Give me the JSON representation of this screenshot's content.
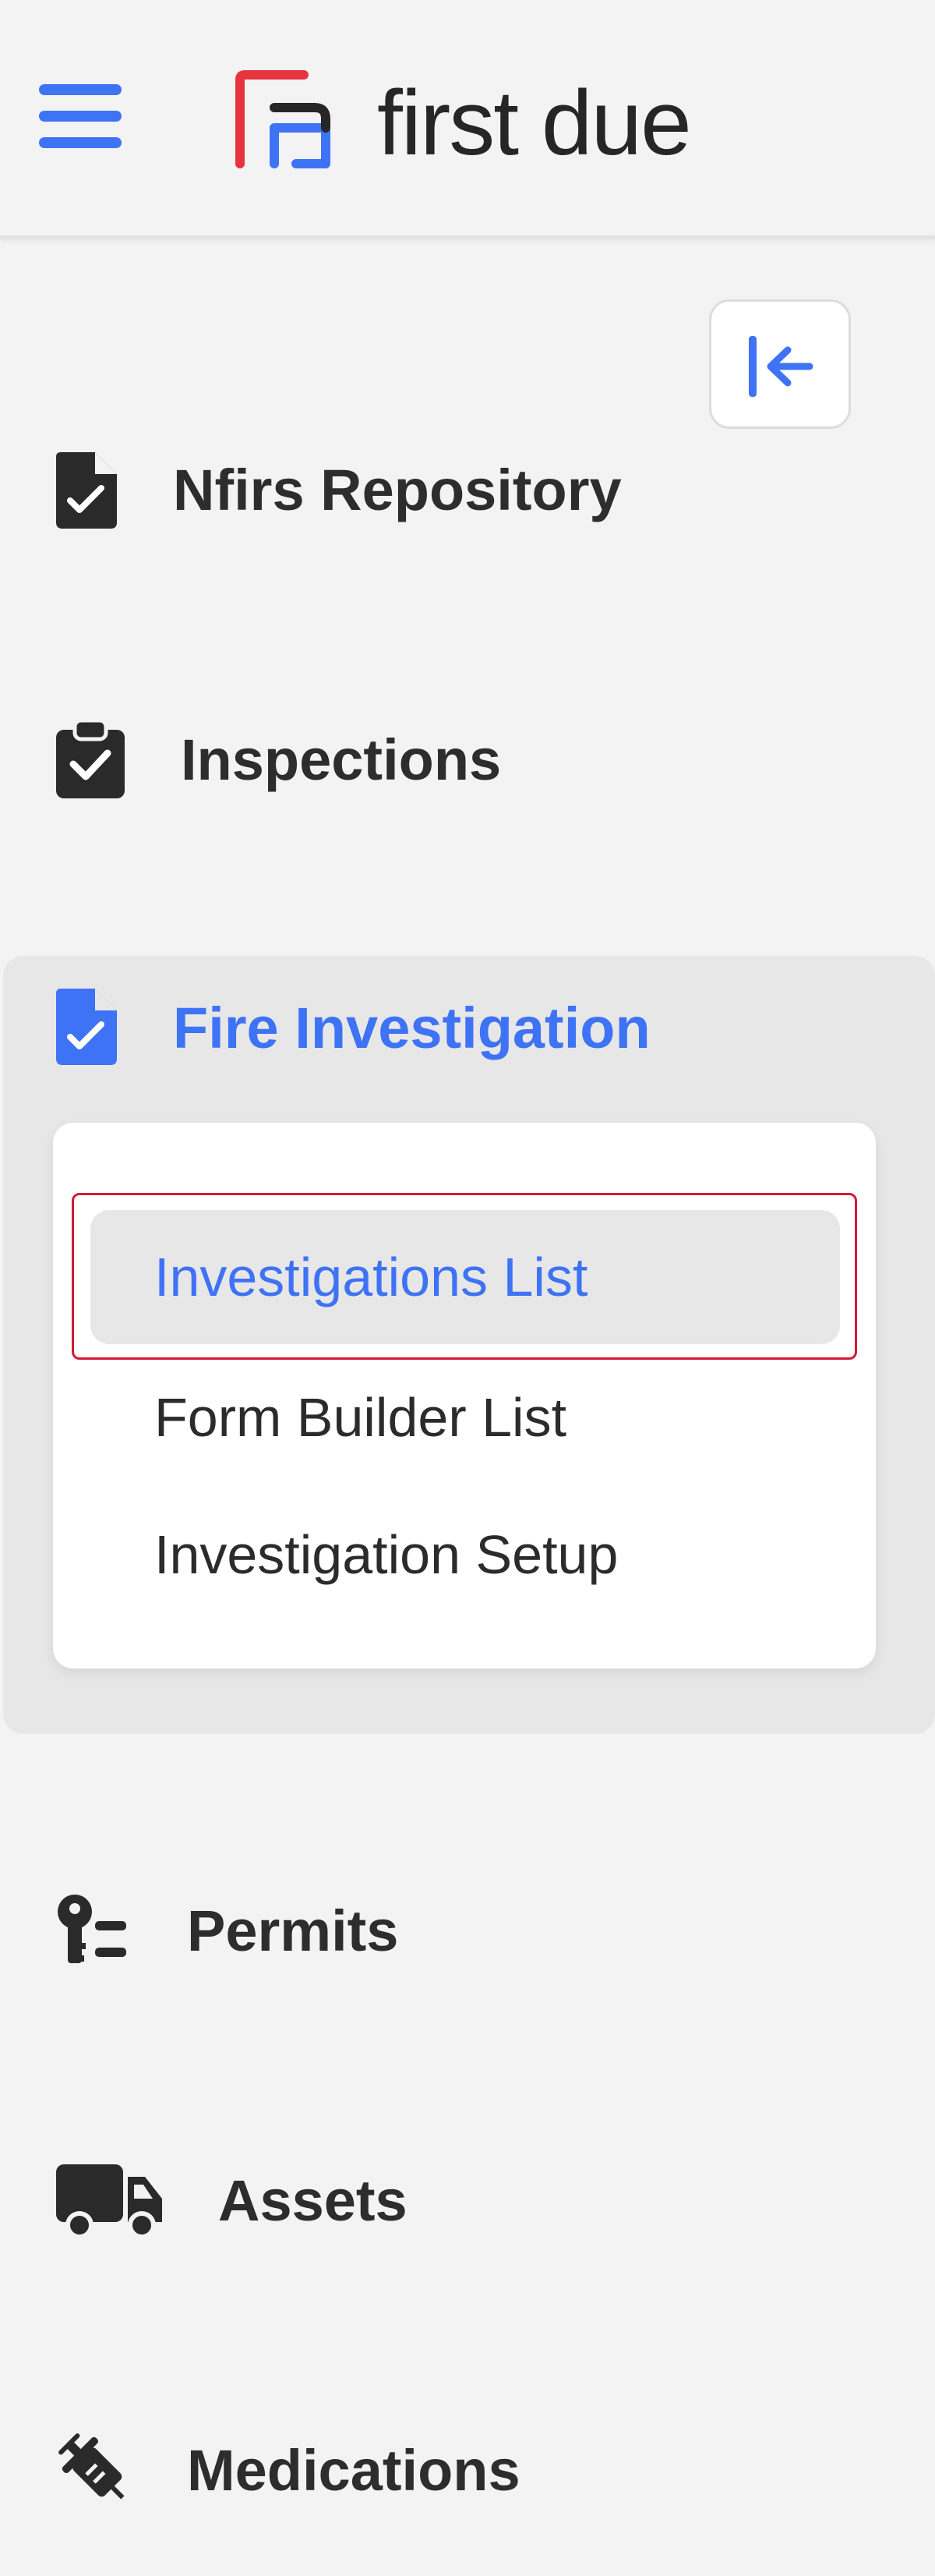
{
  "header": {
    "brand": "first due",
    "menu_icon": "hamburger-icon",
    "brand_color": "#3f73f5",
    "logo_accent_color": "#e8343f"
  },
  "sidebar": {
    "collapse_icon": "collapse-left-icon",
    "items": [
      {
        "label": "Nfirs Repository",
        "icon": "file-check-icon"
      },
      {
        "label": "Inspections",
        "icon": "clipboard-check-icon"
      },
      {
        "label": "Fire Investigation",
        "icon": "file-check-icon",
        "active": true
      },
      {
        "label": "Permits",
        "icon": "key-list-icon"
      },
      {
        "label": "Assets",
        "icon": "truck-icon"
      },
      {
        "label": "Medications",
        "icon": "syringe-icon"
      }
    ],
    "fire_investigation_submenu": [
      {
        "label": "Investigations List",
        "active": true
      },
      {
        "label": "Form Builder List"
      },
      {
        "label": "Investigation Setup"
      }
    ]
  }
}
